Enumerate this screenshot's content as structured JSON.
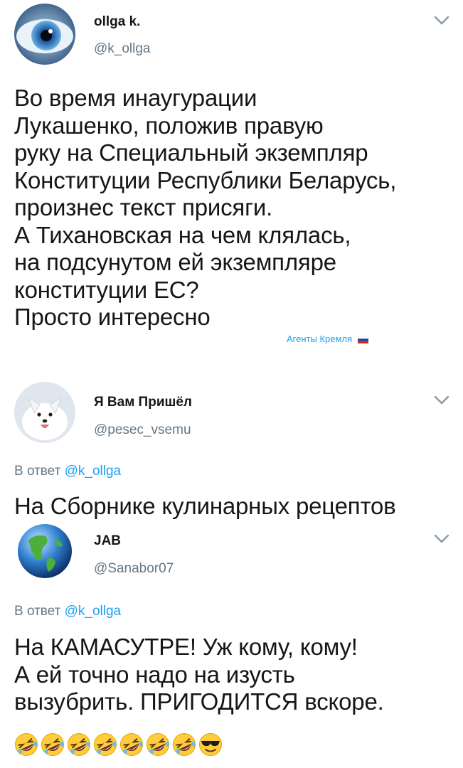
{
  "tweets": [
    {
      "name": "ollga k.",
      "handle": "@k_ollga",
      "text": "Во время инаугурации\nЛукашенко, положив правую\nруку на Специальный экземпляр\nКонституции Республики Беларусь,\nпроизнес текст присяги.\nА Тихановская на чем клялась,\nна подсунутом ей экземпляре\nконституции ЕС?\nПросто интересно"
    },
    {
      "name": "Я Вам Пришёл",
      "handle": "@pesec_vsemu",
      "reply_prefix": "В ответ",
      "reply_to": "@k_ollga",
      "text": "На Сборнике кулинарных рецептов"
    },
    {
      "name": "JAB",
      "handle": "@Sanabor07",
      "reply_prefix": "В ответ",
      "reply_to": "@k_ollga",
      "text": "На КАМАСУТРЕ! Уж кому, кому!\nА ей точно надо на изусть\nвызубрить. ПРИГОДИТСЯ вскоре."
    }
  ],
  "watermark": "Агенты Кремля",
  "emojis": [
    "rolling-on-floor-laughing",
    "rolling-on-floor-laughing",
    "rolling-on-floor-laughing",
    "rolling-on-floor-laughing",
    "rolling-on-floor-laughing",
    "rolling-on-floor-laughing",
    "rolling-on-floor-laughing",
    "smiling-face-with-sunglasses"
  ],
  "colors": {
    "handle": "#657786",
    "link": "#1da1f2",
    "text": "#14171a"
  }
}
